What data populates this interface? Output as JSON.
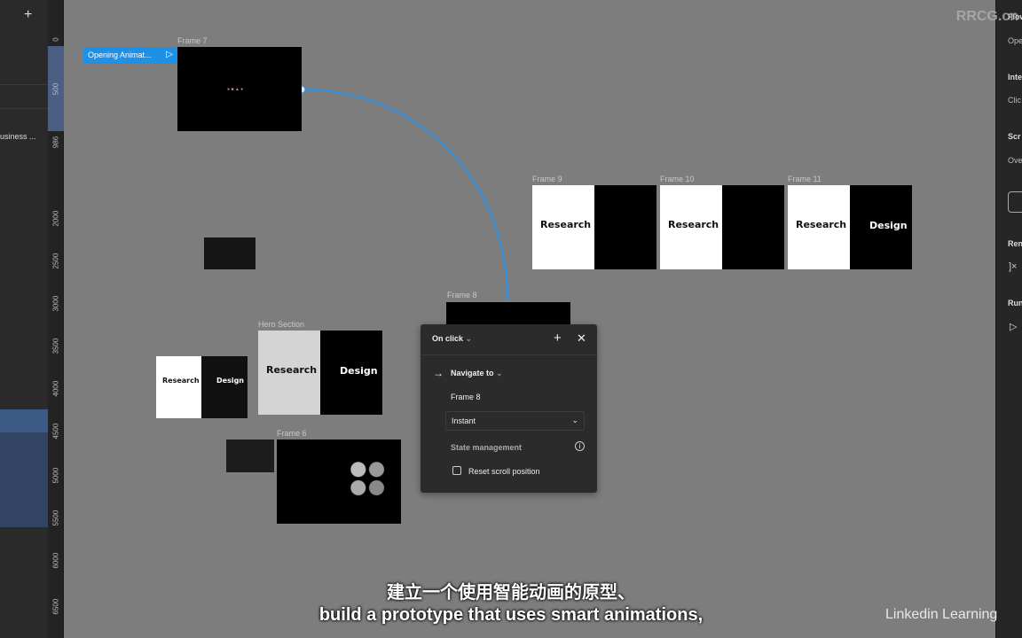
{
  "left_panel": {
    "add_icon": "plus-icon",
    "layer_name": "usiness ..."
  },
  "ruler": {
    "labels": [
      "0",
      "500",
      "986",
      "2000",
      "2500",
      "3000",
      "3500",
      "4000",
      "4500",
      "5000",
      "5500",
      "6000",
      "6500"
    ]
  },
  "canvas": {
    "flow_label": "Opening Animat...",
    "flow_icon": "play-frame-icon",
    "frames": {
      "frame7": "Frame 7",
      "frame8": "Frame 8",
      "frame9": "Frame 9",
      "frame10": "Frame 10",
      "frame11": "Frame 11",
      "hero": "Hero Section",
      "frame6": "Frame 6"
    },
    "research": "Research",
    "design": "Design"
  },
  "popup": {
    "trigger": "On click",
    "action": "Navigate to",
    "destination": "Frame 8",
    "animation": "Instant",
    "state_management": "State management",
    "reset_scroll": "Reset scroll position",
    "reset_scroll_checked": false
  },
  "right_panel": {
    "items": [
      "Flow",
      "Ope",
      "Inte",
      "Clic",
      "Scr",
      "Ove",
      "Ren",
      "Run"
    ]
  },
  "subtitles": {
    "zh": "建立一个使用智能动画的原型、",
    "en": "build a prototype that uses smart animations,"
  },
  "watermarks": {
    "site": "RRCG.cn",
    "brand": "Linkedin Learning"
  },
  "colors": {
    "accent": "#1e90e6",
    "canvas": "#7d7d7d"
  }
}
